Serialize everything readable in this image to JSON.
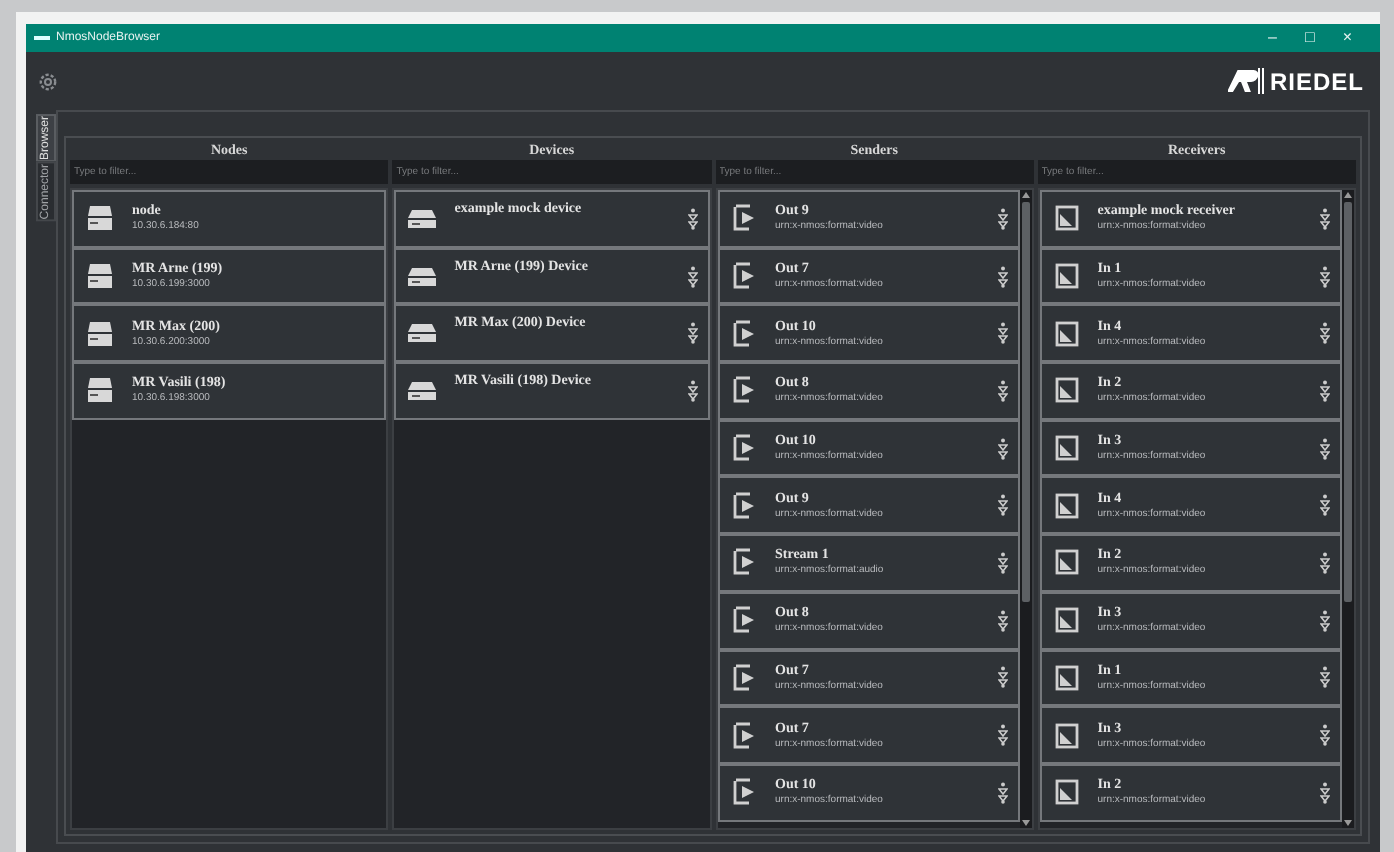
{
  "window": {
    "title": "NmosNodeBrowser",
    "controls": [
      "–",
      "□",
      "×"
    ]
  },
  "logo": {
    "text": "RIEDEL"
  },
  "side_tabs": [
    {
      "label": "Browser",
      "selected": true
    },
    {
      "label": "Connector",
      "selected": false
    }
  ],
  "columns": [
    {
      "kind": "node",
      "title": "Nodes",
      "filter": {
        "placeholder": "Type to filter..."
      },
      "items": [
        {
          "name": "node",
          "detail": "10.30.6.184:80"
        },
        {
          "name": "MR Arne (199)",
          "detail": "10.30.6.199:3000"
        },
        {
          "name": "MR Max (200)",
          "detail": "10.30.6.200:3000"
        },
        {
          "name": "MR Vasili (198)",
          "detail": "10.30.6.198:3000"
        }
      ]
    },
    {
      "kind": "device",
      "title": "Devices",
      "filter": {
        "placeholder": "Type to filter..."
      },
      "items": [
        {
          "name": "example mock device"
        },
        {
          "name": "MR Arne (199) Device"
        },
        {
          "name": "MR Max (200) Device"
        },
        {
          "name": "MR Vasili (198) Device"
        }
      ]
    },
    {
      "kind": "sender",
      "title": "Senders",
      "filter": {
        "placeholder": "Type to filter..."
      },
      "items": [
        {
          "name": "Out 9",
          "detail": "urn:x-nmos:format:video"
        },
        {
          "name": "Out 7",
          "detail": "urn:x-nmos:format:video"
        },
        {
          "name": "Out 10",
          "detail": "urn:x-nmos:format:video"
        },
        {
          "name": "Out 8",
          "detail": "urn:x-nmos:format:video"
        },
        {
          "name": "Out 10",
          "detail": "urn:x-nmos:format:video"
        },
        {
          "name": "Out 9",
          "detail": "urn:x-nmos:format:video"
        },
        {
          "name": "Stream 1",
          "detail": "urn:x-nmos:format:audio"
        },
        {
          "name": "Out 8",
          "detail": "urn:x-nmos:format:video"
        },
        {
          "name": "Out 7",
          "detail": "urn:x-nmos:format:video"
        },
        {
          "name": "Out 7",
          "detail": "urn:x-nmos:format:video"
        },
        {
          "name": "Out 10",
          "detail": "urn:x-nmos:format:video"
        }
      ]
    },
    {
      "kind": "receiver",
      "title": "Receivers",
      "filter": {
        "placeholder": "Type to filter..."
      },
      "items": [
        {
          "name": "example mock receiver",
          "detail": "urn:x-nmos:format:video"
        },
        {
          "name": "In 1",
          "detail": "urn:x-nmos:format:video"
        },
        {
          "name": "In 4",
          "detail": "urn:x-nmos:format:video"
        },
        {
          "name": "In 2",
          "detail": "urn:x-nmos:format:video"
        },
        {
          "name": "In 3",
          "detail": "urn:x-nmos:format:video"
        },
        {
          "name": "In 4",
          "detail": "urn:x-nmos:format:video"
        },
        {
          "name": "In 2",
          "detail": "urn:x-nmos:format:video"
        },
        {
          "name": "In 3",
          "detail": "urn:x-nmos:format:video"
        },
        {
          "name": "In 1",
          "detail": "urn:x-nmos:format:video"
        },
        {
          "name": "In 3",
          "detail": "urn:x-nmos:format:video"
        },
        {
          "name": "In 2",
          "detail": "urn:x-nmos:format:video"
        }
      ]
    }
  ]
}
